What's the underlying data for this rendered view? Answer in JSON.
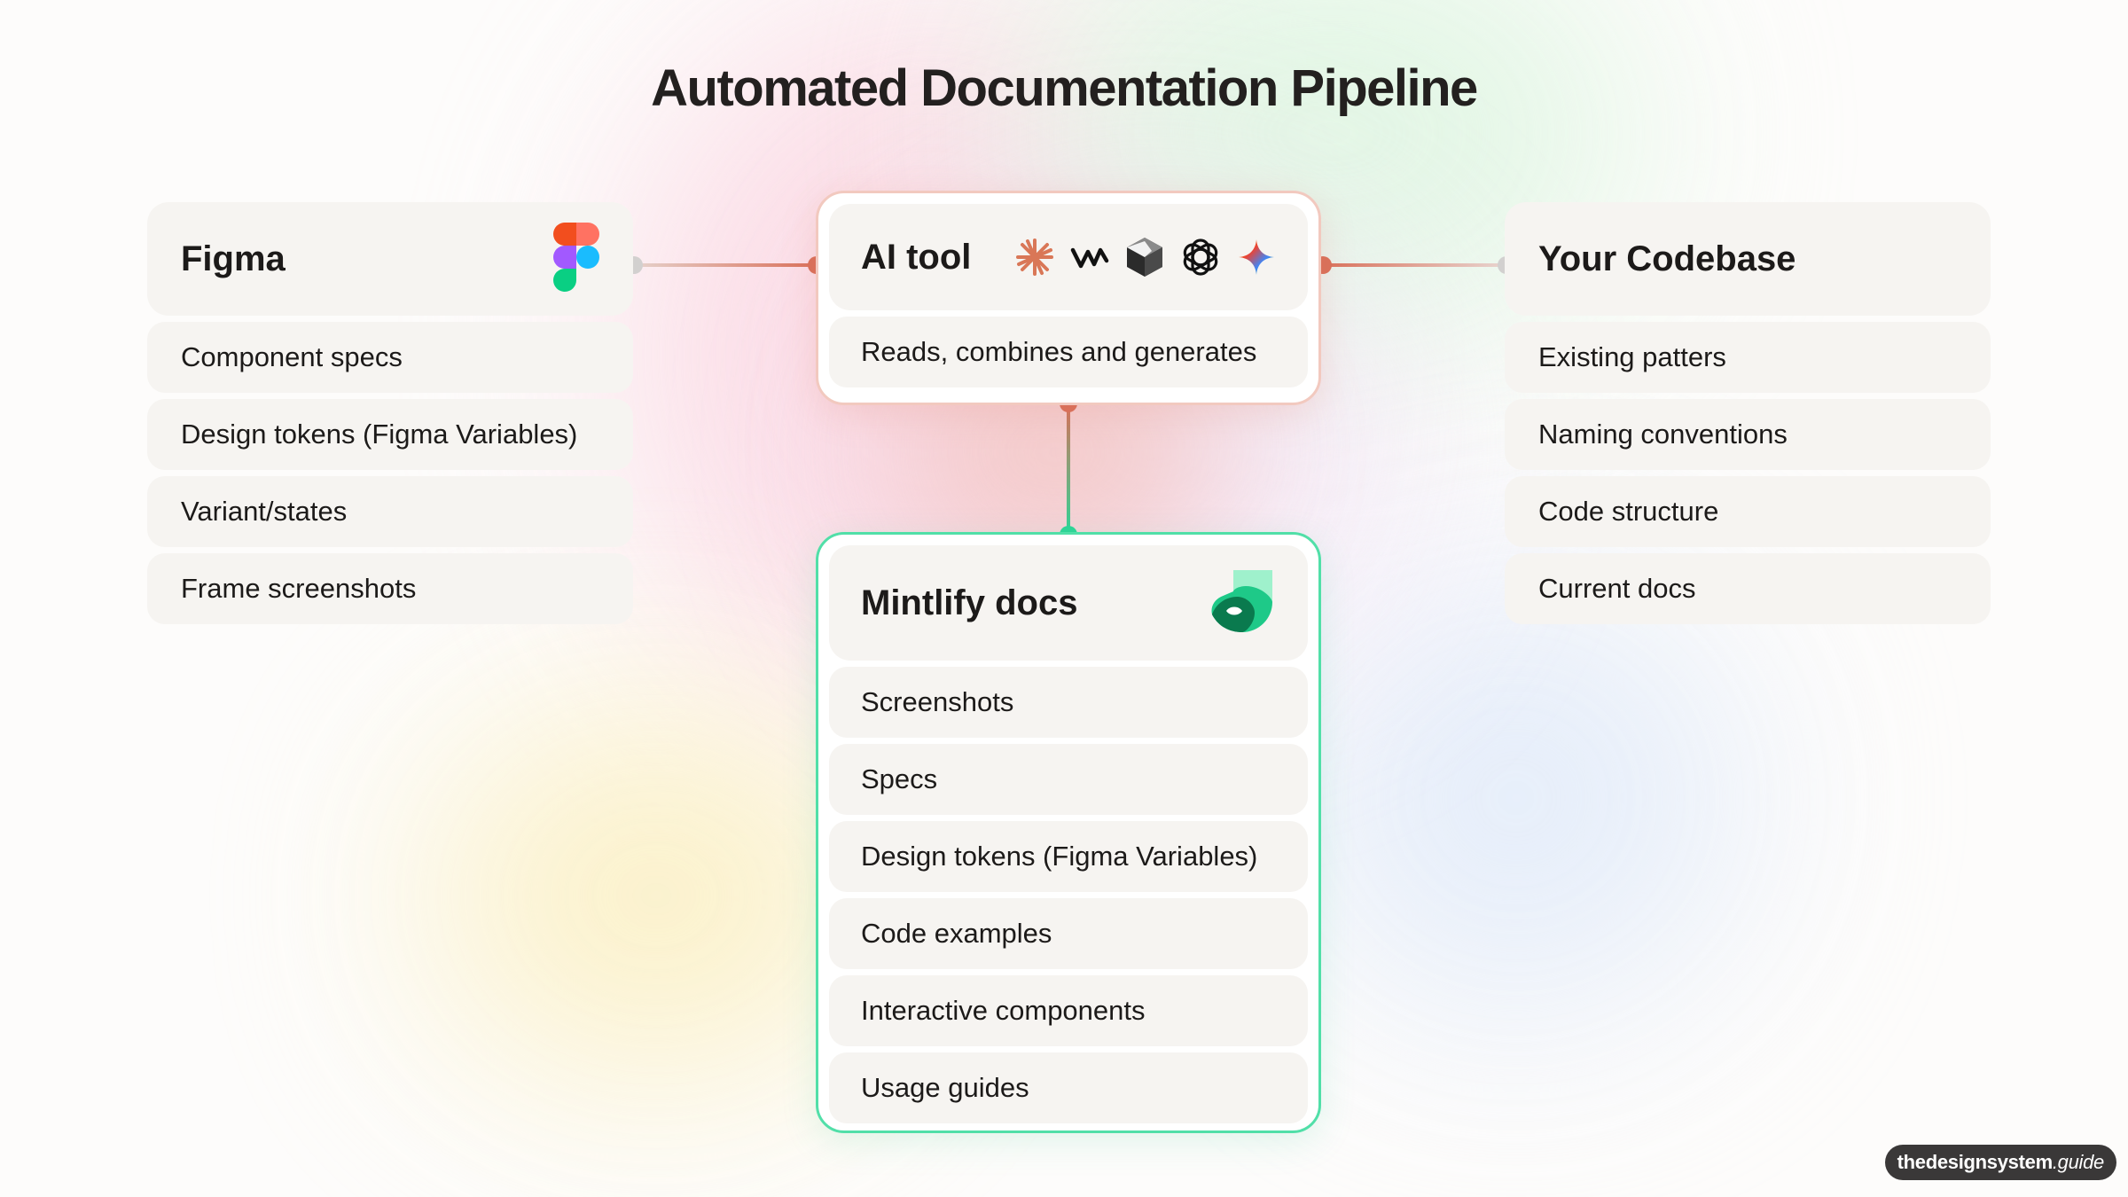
{
  "title": "Automated Documentation Pipeline",
  "figma": {
    "title": "Figma",
    "icon": "figma-logo-icon",
    "items": [
      "Component specs",
      "Design tokens (Figma Variables)",
      "Variant/states",
      "Frame screenshots"
    ]
  },
  "ai_tool": {
    "title": "AI tool",
    "icons": [
      "claude-icon",
      "windsurf-icon",
      "cursor-icon",
      "openai-icon",
      "gemini-icon"
    ],
    "items": [
      "Reads, combines and generates"
    ]
  },
  "codebase": {
    "title": "Your Codebase",
    "items": [
      "Existing patters",
      "Naming conventions",
      "Code structure",
      "Current docs"
    ]
  },
  "mintlify": {
    "title": "Mintlify docs",
    "icon": "mintlify-logo-icon",
    "items": [
      "Screenshots",
      "Specs",
      "Design tokens (Figma Variables)",
      "Code examples",
      "Interactive components",
      "Usage guides"
    ]
  },
  "watermark": {
    "bold": "thedesignsystem",
    "italic": ".guide"
  },
  "colors": {
    "connector_orange": "#d9705a",
    "connector_green": "#2fd597",
    "connector_grey": "#c9c9c9",
    "mint_border": "#51dfa8",
    "ai_border": "#f2c9bf"
  }
}
